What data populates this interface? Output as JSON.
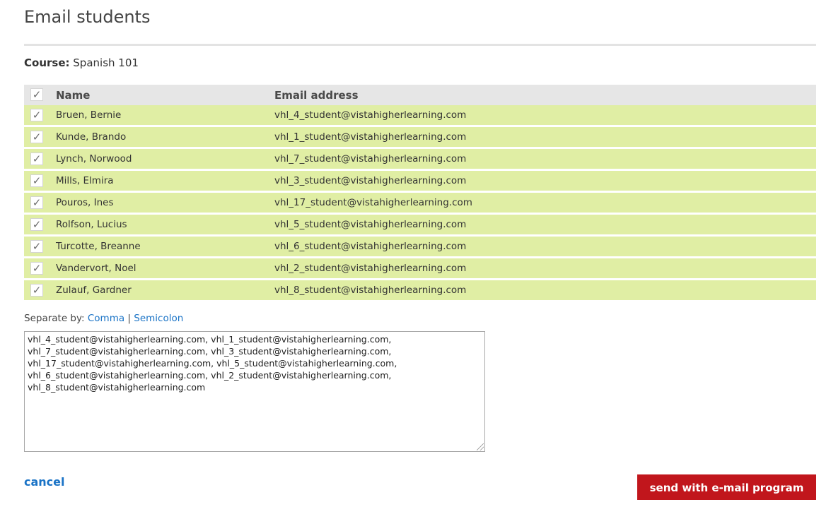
{
  "page": {
    "title": "Email students"
  },
  "course": {
    "label": "Course:",
    "value": "Spanish 101"
  },
  "table": {
    "header": {
      "name": "Name",
      "email": "Email address",
      "check": "✓"
    },
    "rows": [
      {
        "check": "✓",
        "name": "Bruen, Bernie",
        "email": "vhl_4_student@vistahigherlearning.com"
      },
      {
        "check": "✓",
        "name": "Kunde, Brando",
        "email": "vhl_1_student@vistahigherlearning.com"
      },
      {
        "check": "✓",
        "name": "Lynch, Norwood",
        "email": "vhl_7_student@vistahigherlearning.com"
      },
      {
        "check": "✓",
        "name": "Mills, Elmira",
        "email": "vhl_3_student@vistahigherlearning.com"
      },
      {
        "check": "✓",
        "name": "Pouros, Ines",
        "email": "vhl_17_student@vistahigherlearning.com"
      },
      {
        "check": "✓",
        "name": "Rolfson, Lucius",
        "email": "vhl_5_student@vistahigherlearning.com"
      },
      {
        "check": "✓",
        "name": "Turcotte, Breanne",
        "email": "vhl_6_student@vistahigherlearning.com"
      },
      {
        "check": "✓",
        "name": "Vandervort, Noel",
        "email": "vhl_2_student@vistahigherlearning.com"
      },
      {
        "check": "✓",
        "name": "Zulauf, Gardner",
        "email": "vhl_8_student@vistahigherlearning.com"
      }
    ]
  },
  "separator": {
    "label": "Separate by:",
    "comma": "Comma",
    "pipe": "|",
    "semicolon": "Semicolon"
  },
  "addresses_text": "vhl_4_student@vistahigherlearning.com, vhl_1_student@vistahigherlearning.com,\nvhl_7_student@vistahigherlearning.com, vhl_3_student@vistahigherlearning.com,\nvhl_17_student@vistahigherlearning.com, vhl_5_student@vistahigherlearning.com,\nvhl_6_student@vistahigherlearning.com, vhl_2_student@vistahigherlearning.com,\nvhl_8_student@vistahigherlearning.com",
  "actions": {
    "cancel": "cancel",
    "send": "send with e-mail program"
  },
  "colors": {
    "row_bg": "#e0eea4",
    "header_bg": "#e6e6e6",
    "link": "#1a73c6",
    "send_button": "#c1161c"
  }
}
